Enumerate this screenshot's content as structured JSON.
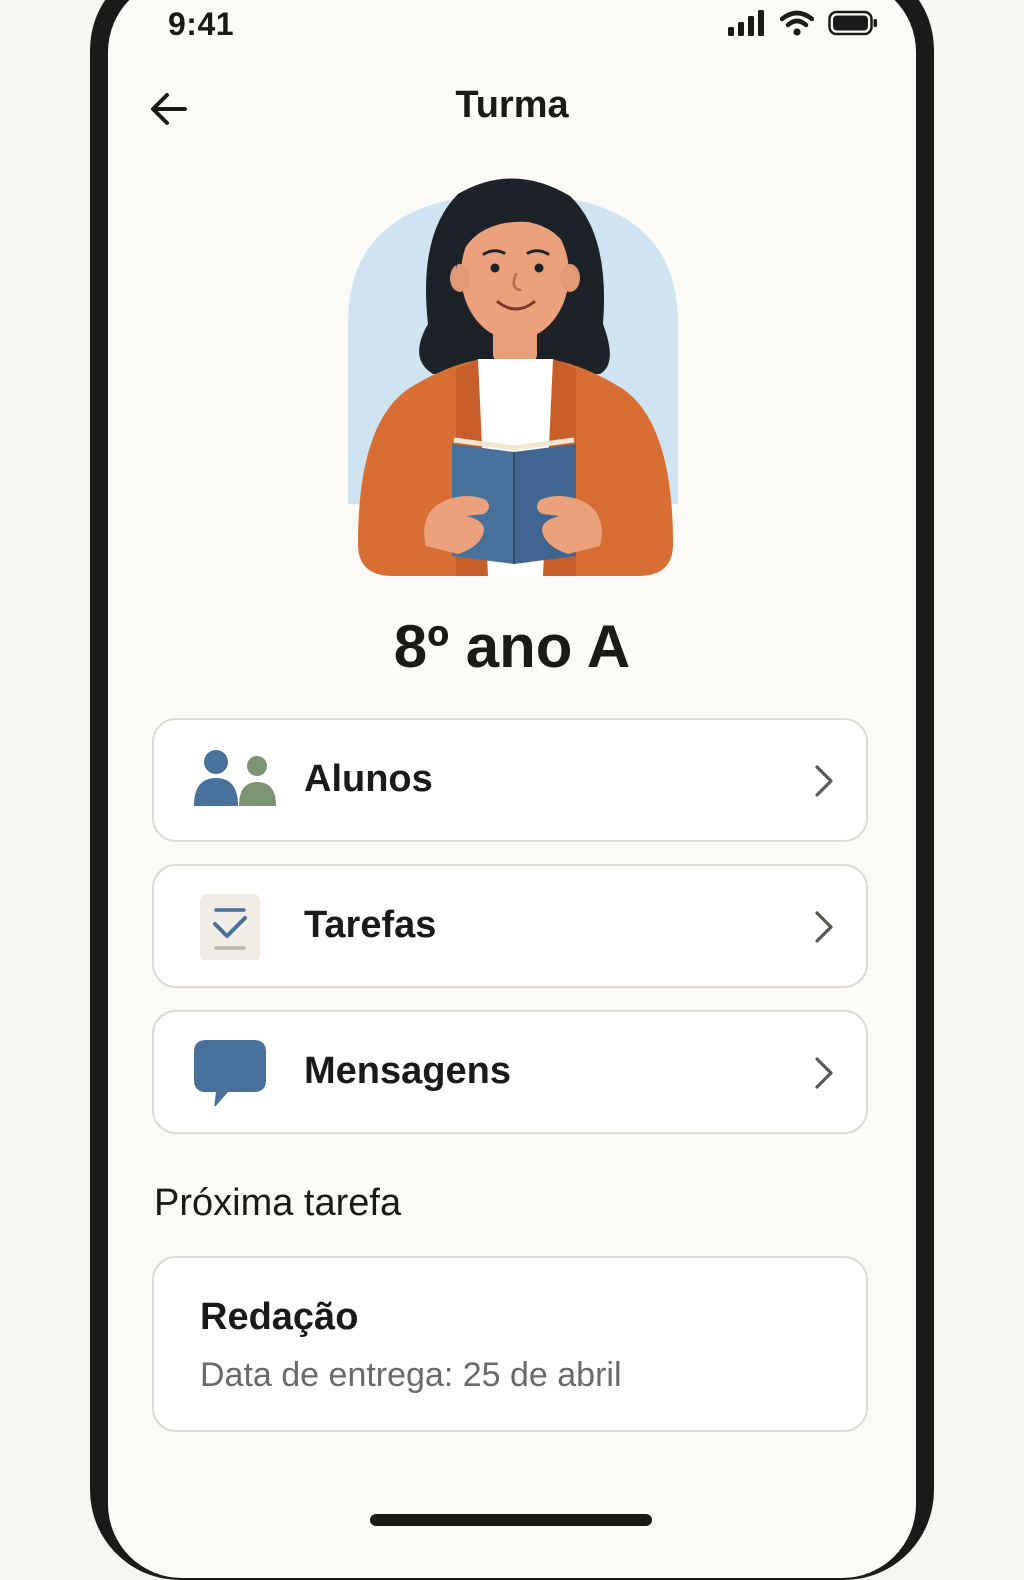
{
  "status_bar": {
    "time": "9:41"
  },
  "header": {
    "title": "Turma",
    "back_icon": "arrow-left-icon"
  },
  "class": {
    "name": "8º ano A"
  },
  "menu": {
    "items": [
      {
        "label": "Alunos",
        "icon": "students-icon"
      },
      {
        "label": "Tarefas",
        "icon": "task-checklist-icon"
      },
      {
        "label": "Mensagens",
        "icon": "chat-bubble-icon"
      }
    ]
  },
  "next_task": {
    "section_title": "Próxima tarefa",
    "title": "Redação",
    "due": "Data de entrega: 25 de abril"
  },
  "colors": {
    "accent_blue": "#47709a",
    "accent_green": "#7c9471",
    "orange_cardigan": "#d96e35",
    "background": "#fbfaf7",
    "border": "#dedbd5"
  }
}
